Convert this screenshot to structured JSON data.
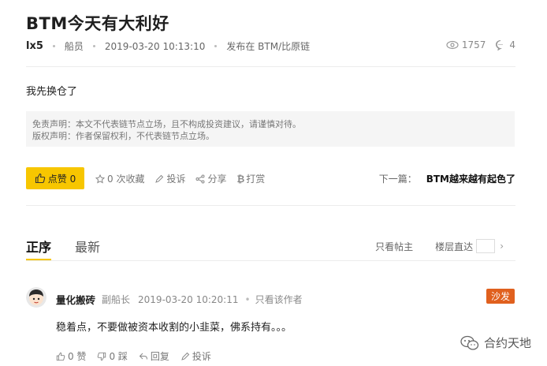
{
  "post": {
    "title": "BTM今天有大利好",
    "author": "lx5",
    "role": "船员",
    "time": "2019-03-20 10:13:10",
    "published_in": "发布在 BTM/比原链",
    "views": "1757",
    "comments": "4",
    "content": "我先换仓了",
    "disclaimer_line1": "免责声明：本文不代表链节点立场，且不构成投资建议，请谨慎对待。",
    "disclaimer_line2": "版权声明：作者保留权利，不代表链节点立场。"
  },
  "actions": {
    "like": "点赞 0",
    "favorite": "0 次收藏",
    "report": "投诉",
    "share": "分享",
    "tip": "打赏"
  },
  "next_post": {
    "label": "下一篇：",
    "title": "BTM越来越有起色了"
  },
  "tabs": [
    "正序",
    "最新"
  ],
  "filters": {
    "owner_only": "只看帖主",
    "floor_jump": "楼层直达"
  },
  "comment": {
    "name": "量化搬砖",
    "role": "副船长",
    "time": "2019-03-20 10:20:11",
    "author_only": "只看该作者",
    "badge": "沙发",
    "text": "稳着点，不要做被资本收割的小韭菜，佛系持有。。。",
    "like": "0 赞",
    "dislike": "0 踩",
    "reply": "回复",
    "report": "投诉"
  },
  "watermark": "合约天地",
  "colors": {
    "accent": "#f7c600",
    "sofa": "#e0601e"
  }
}
